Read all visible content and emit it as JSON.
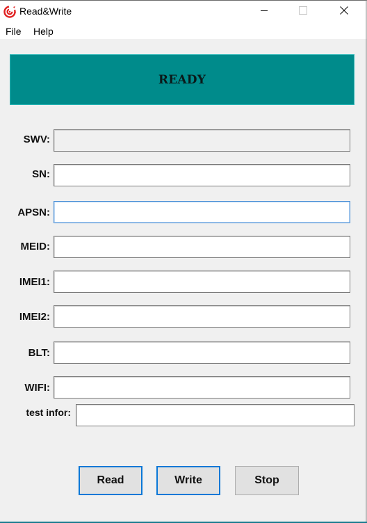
{
  "window": {
    "title": "Read&Write",
    "app_icon": "swirl-logo-icon",
    "controls": [
      "minimize-icon",
      "maximize-icon",
      "close-icon"
    ]
  },
  "menu": {
    "items": [
      {
        "label": "File"
      },
      {
        "label": "Help"
      }
    ]
  },
  "status": {
    "text": "READY",
    "background": "#008b8b"
  },
  "fields": [
    {
      "label": "SWV:",
      "value": "",
      "readonly": true
    },
    {
      "label": "SN:",
      "value": ""
    },
    {
      "label": "APSN:",
      "value": "",
      "focused": true
    },
    {
      "label": "MEID:",
      "value": ""
    },
    {
      "label": "IMEI1:",
      "value": ""
    },
    {
      "label": "IMEI2:",
      "value": ""
    },
    {
      "label": "BLT:",
      "value": ""
    },
    {
      "label": "WIFI:",
      "value": ""
    },
    {
      "label": "test infor:",
      "value": ""
    }
  ],
  "buttons": {
    "read": "Read",
    "write": "Write",
    "stop": "Stop"
  },
  "colors": {
    "accent": "#0a78d7",
    "status_bg": "#008b8b"
  }
}
